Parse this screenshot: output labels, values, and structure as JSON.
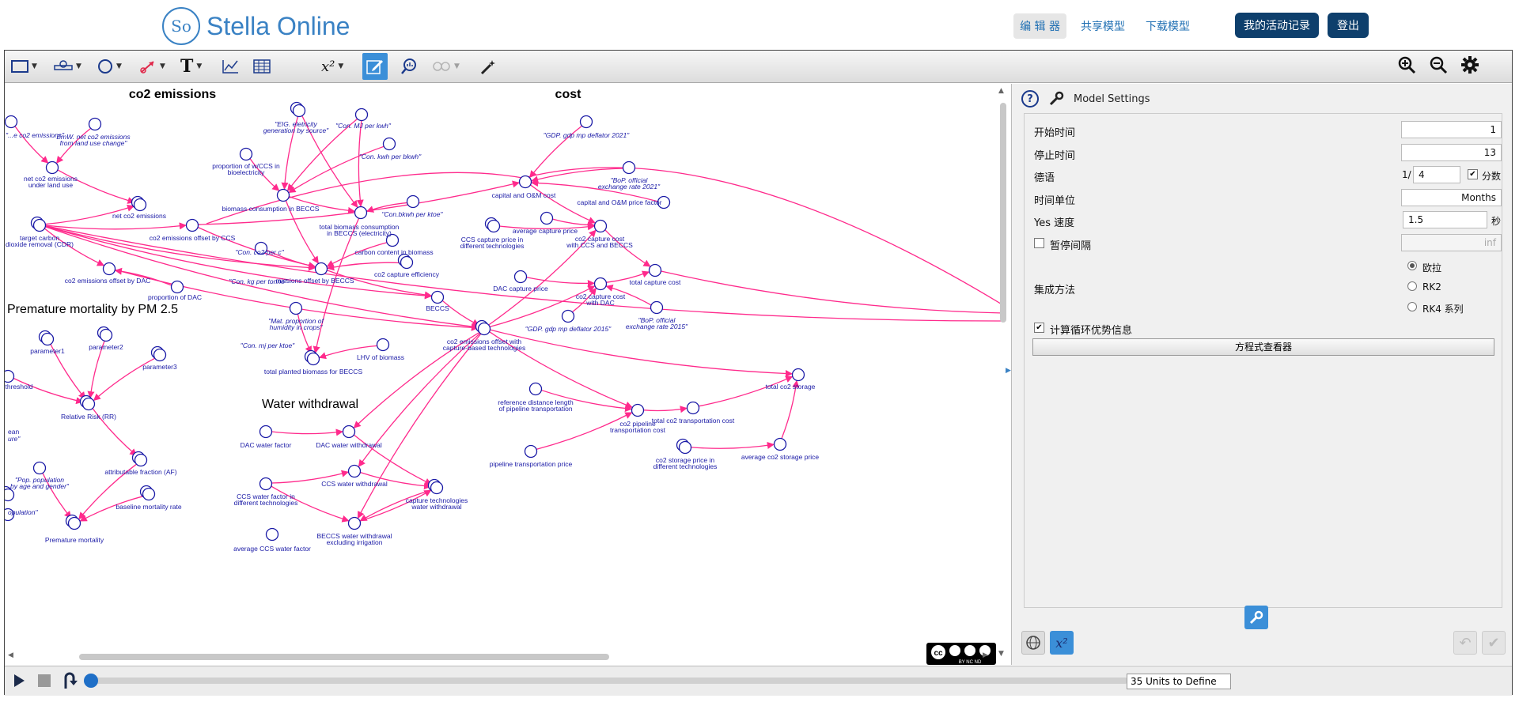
{
  "header": {
    "logo_text": "Stella Online",
    "logo_mark": "So",
    "nav": [
      {
        "label": "编 辑 器",
        "active": true
      },
      {
        "label": "共享模型",
        "active": false
      },
      {
        "label": "下载模型",
        "active": false
      }
    ],
    "activity_button": "我的活动记录",
    "logout_button": "登出"
  },
  "toolbar": {
    "tools": [
      "stock-tool",
      "flow-tool",
      "converter-tool",
      "connector-tool",
      "text-tool",
      "graph-tool",
      "table-tool",
      "equation-tool",
      "edit-mode",
      "explore-tool",
      "loop-tool",
      "magic-tool"
    ],
    "right": [
      "zoom-in",
      "zoom-out",
      "settings"
    ]
  },
  "diagram": {
    "sections": [
      {
        "id": "s1",
        "text": "co2 emissions"
      },
      {
        "id": "s2",
        "text": "cost"
      },
      {
        "id": "s3",
        "text": "Premature mortality by PM 2.5"
      },
      {
        "id": "s4",
        "text": "Water withdrawal"
      }
    ],
    "labels": [
      {
        "id": "l1",
        "text": "\"...e co2 emissions\"",
        "italic": true
      },
      {
        "id": "l2",
        "text": "EmW. net co2 emissions",
        "italic": true
      },
      {
        "id": "l3",
        "text": "from land use change\"",
        "italic": true
      },
      {
        "id": "l4",
        "text": "net co2 emissions"
      },
      {
        "id": "l5",
        "text": "under land use"
      },
      {
        "id": "l6",
        "text": "net co2 emissions"
      },
      {
        "id": "l7",
        "text": "target carbon"
      },
      {
        "id": "l8",
        "text": "dioxide removal (CDR)"
      },
      {
        "id": "l9",
        "text": "co2 emissions offset by DAC"
      },
      {
        "id": "l10",
        "text": "proportion of DAC"
      },
      {
        "id": "l11",
        "text": "\"EIG. eletricity",
        "italic": true
      },
      {
        "id": "l12",
        "text": "generation by source\"",
        "italic": true
      },
      {
        "id": "l13",
        "text": "\"Con. MJ per kwh\"",
        "italic": true
      },
      {
        "id": "l14",
        "text": "\"Con. kwh per bkwh\"",
        "italic": true
      },
      {
        "id": "l15",
        "text": "proportion of w/CCS in"
      },
      {
        "id": "l16",
        "text": "bioelectricity"
      },
      {
        "id": "l17",
        "text": "biomass consumption in BECCS"
      },
      {
        "id": "l18",
        "text": "total biomass consumption"
      },
      {
        "id": "l19",
        "text": "in BECCS (electricity)"
      },
      {
        "id": "l20",
        "text": "\"Con.bkwh per ktoe\"",
        "italic": true
      },
      {
        "id": "l21",
        "text": "co2 emissions offset by CCS"
      },
      {
        "id": "l22",
        "text": "\"Con. co2 per c\"",
        "italic": true
      },
      {
        "id": "l23",
        "text": "carbon content in biomass"
      },
      {
        "id": "l24",
        "text": "\"Con. kg per tonne\"",
        "italic": true
      },
      {
        "id": "l25",
        "text": "missions offset by BECCS"
      },
      {
        "id": "l26",
        "text": "co2 capture efficiency"
      },
      {
        "id": "l27",
        "text": "BECCS"
      },
      {
        "id": "l28",
        "text": "\"Mat. proportion of",
        "italic": true
      },
      {
        "id": "l29",
        "text": "humidity in crops\"",
        "italic": true
      },
      {
        "id": "l30",
        "text": "\"Con. mj per ktoe\"",
        "italic": true
      },
      {
        "id": "l31",
        "text": "LHV of biomass"
      },
      {
        "id": "l32",
        "text": "total planted biomass for BECCS"
      },
      {
        "id": "l33",
        "text": "\"GDP. gdp mp deflator 2021\"",
        "italic": true
      },
      {
        "id": "l34",
        "text": "capital and O&M cost"
      },
      {
        "id": "l35",
        "text": "\"BoP. official",
        "italic": true
      },
      {
        "id": "l36",
        "text": "exchange rate 2021\"",
        "italic": true
      },
      {
        "id": "l37",
        "text": "capital and O&M price factor"
      },
      {
        "id": "l38",
        "text": "CCS capture price in"
      },
      {
        "id": "l39",
        "text": "different technologies"
      },
      {
        "id": "l40",
        "text": "average capture price"
      },
      {
        "id": "l41",
        "text": "co2 capture cost"
      },
      {
        "id": "l42",
        "text": "with CCS and BECCS"
      },
      {
        "id": "l43",
        "text": "DAC capture price"
      },
      {
        "id": "l44",
        "text": "total capture cost"
      },
      {
        "id": "l45",
        "text": "co2 capture cost"
      },
      {
        "id": "l46",
        "text": "with DAC"
      },
      {
        "id": "l47",
        "text": "\"BoP. official",
        "italic": true
      },
      {
        "id": "l48",
        "text": "exchange rate 2015\"",
        "italic": true
      },
      {
        "id": "l49",
        "text": "\"GDP. gdp mp deflator 2015\"",
        "italic": true
      },
      {
        "id": "l50",
        "text": "co2 emissions offset with"
      },
      {
        "id": "l51",
        "text": "capture-based technologies"
      },
      {
        "id": "l52",
        "text": "total co2 storage"
      },
      {
        "id": "l53",
        "text": "reference distance length"
      },
      {
        "id": "l54",
        "text": "of pipeline transportation"
      },
      {
        "id": "l55",
        "text": "co2 pipeline"
      },
      {
        "id": "l56",
        "text": "transportation cost"
      },
      {
        "id": "l57",
        "text": "total co2 transportation cost"
      },
      {
        "id": "l58",
        "text": "pipeline transportation price"
      },
      {
        "id": "l59",
        "text": "co2 storage price in"
      },
      {
        "id": "l60",
        "text": "different technologies"
      },
      {
        "id": "l61",
        "text": "average co2 storage price"
      },
      {
        "id": "l62",
        "text": "parameter1"
      },
      {
        "id": "l63",
        "text": "parameter2"
      },
      {
        "id": "l64",
        "text": "parameter3"
      },
      {
        "id": "l65",
        "text": "threshold"
      },
      {
        "id": "l66",
        "text": "Relative Risk (RR)"
      },
      {
        "id": "l67",
        "text": "ean"
      },
      {
        "id": "l68",
        "text": "ure\"",
        "italic": true
      },
      {
        "id": "l69",
        "text": "attributable fraction (AF)"
      },
      {
        "id": "l70",
        "text": "\"Pop. population",
        "italic": true
      },
      {
        "id": "l71",
        "text": "by age and gender\"",
        "italic": true
      },
      {
        "id": "l72",
        "text": "baseline mortality rate"
      },
      {
        "id": "l73",
        "text": "opulation\"",
        "italic": true
      },
      {
        "id": "l74",
        "text": "Premature mortality"
      },
      {
        "id": "l75",
        "text": "DAC water factor"
      },
      {
        "id": "l76",
        "text": "DAC water withdrawal"
      },
      {
        "id": "l77",
        "text": "CCS water withdrawal"
      },
      {
        "id": "l78",
        "text": "CCS water factor in"
      },
      {
        "id": "l79",
        "text": "different technologies"
      },
      {
        "id": "l80",
        "text": "capture technologies"
      },
      {
        "id": "l81",
        "text": "water withdrawal"
      },
      {
        "id": "l82",
        "text": "BECCS water withdrawal"
      },
      {
        "id": "l83",
        "text": "excluding irrigation"
      },
      {
        "id": "l84",
        "text": "average CCS water factor"
      }
    ],
    "license_badge": "BY NC ND"
  },
  "settings": {
    "title": "Model Settings",
    "start_label": "开始时间",
    "start_value": "1",
    "stop_label": "停止时间",
    "stop_value": "13",
    "dt_label": "德语",
    "dt_prefix": "1/",
    "dt_value": "4",
    "dt_fraction_label": "分数",
    "dt_fraction_checked": true,
    "unit_label": "时间单位",
    "unit_value": "Months",
    "speed_label": "Yes 速度",
    "speed_value": "1.5",
    "speed_unit": "秒",
    "pause_label": "暂停间隔",
    "pause_checked": false,
    "pause_value": "inf",
    "method_label": "集成方法",
    "methods": [
      "欧拉",
      "RK2",
      "RK4 系列"
    ],
    "selected_method": "欧拉",
    "loop_label": "计算循环优势信息",
    "loop_checked": true,
    "equation_viewer": "方程式查看器"
  },
  "timeline": {
    "units_select": "35 Units to Define",
    "progress": 0
  },
  "colors": {
    "brand": "#3a82c4",
    "nav_button": "#0e3f6c",
    "link": "#ff2a8c",
    "node": "#1a1aa6"
  }
}
